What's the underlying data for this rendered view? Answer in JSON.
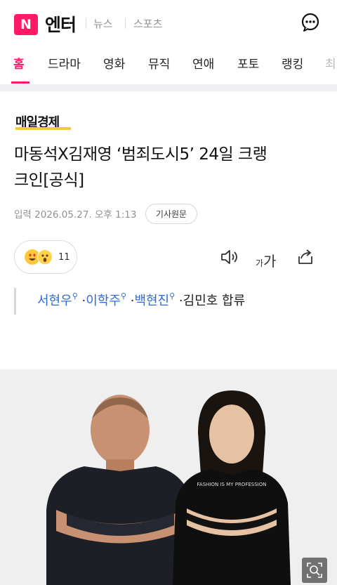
{
  "header": {
    "logo_letter": "N",
    "section": "엔터",
    "links": [
      "뉴스",
      "스포츠"
    ]
  },
  "tabs": [
    "홈",
    "드라마",
    "영화",
    "뮤직",
    "연애",
    "포토",
    "랭킹",
    "최"
  ],
  "article": {
    "press": "매일경제",
    "headline_line1": "마동석X김재영 ‘범죄도시5’ 24일 크랭",
    "headline_line2": "크인[공식]",
    "date": "입력 2026.05.27. 오후 1:13",
    "original_button": "기사원문",
    "reaction_count": "11",
    "font_size_label_small": "가",
    "font_size_label_large": "가",
    "cast": {
      "names": [
        "서현우",
        "이학주",
        "백현진"
      ],
      "separator": "·",
      "tail": "·김민호 합류"
    },
    "photo_shirt_text": "FASHION IS MY PROFESSION"
  },
  "colors": {
    "brand": "#ff1a66",
    "link": "#2f6cd6",
    "press_underline": "#f6c744"
  },
  "icons": [
    "chat-icon",
    "speaker-icon",
    "share-icon",
    "search-zoom-icon",
    "magnifier-icon"
  ]
}
